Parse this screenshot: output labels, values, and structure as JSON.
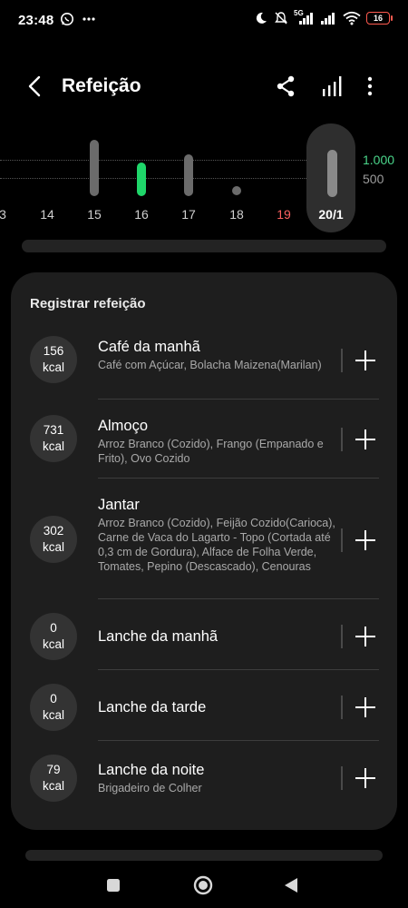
{
  "status_bar": {
    "time": "23:48",
    "network": "5G",
    "battery": "16",
    "left_icons": [
      "whatsapp-icon",
      "more-dots-icon"
    ],
    "right_icons": [
      "do-not-disturb-icon",
      "mute-icon",
      "signal-icon",
      "signal-icon",
      "wifi-icon",
      "battery-icon"
    ]
  },
  "header": {
    "title": "Refeição",
    "icons": [
      "back-icon",
      "share-icon",
      "bar-chart-icon",
      "more-vert-icon"
    ]
  },
  "chart_strip": {
    "scale_top": "1.000",
    "scale_bottom": "500",
    "days": [
      {
        "label": "3"
      },
      {
        "label": "14"
      },
      {
        "label": "15"
      },
      {
        "label": "16"
      },
      {
        "label": "17"
      },
      {
        "label": "18"
      },
      {
        "label": "19"
      },
      {
        "label": "20/1"
      }
    ],
    "colors": {
      "today": "#1fd66a",
      "weekend": "#ff6161",
      "bar": "#6b6b6b"
    }
  },
  "meals_card": {
    "title": "Registrar refeição",
    "meals": [
      {
        "kcal": "156",
        "unit": "kcal",
        "name": "Café da manhã",
        "desc": "Café com Açúcar, Bolacha Maizena(Marilan)"
      },
      {
        "kcal": "731",
        "unit": "kcal",
        "name": "Almoço",
        "desc": "Arroz Branco (Cozido), Frango (Empanado e Frito), Ovo Cozido"
      },
      {
        "kcal": "302",
        "unit": "kcal",
        "name": "Jantar",
        "desc": "Arroz Branco (Cozido), Feijão Cozido(Carioca), Carne de Vaca do Lagarto - Topo (Cortada até 0,3 cm de Gordura), Alface de Folha Verde, Tomates, Pepino (Descascado), Cenouras"
      },
      {
        "kcal": "0",
        "unit": "kcal",
        "name": "Lanche da manhã",
        "desc": ""
      },
      {
        "kcal": "0",
        "unit": "kcal",
        "name": "Lanche da tarde",
        "desc": ""
      },
      {
        "kcal": "79",
        "unit": "kcal",
        "name": "Lanche da noite",
        "desc": "Brigadeiro de Colher"
      }
    ]
  },
  "nav_bar": {
    "icons": [
      "recents-icon",
      "home-icon",
      "back-nav-icon"
    ]
  }
}
